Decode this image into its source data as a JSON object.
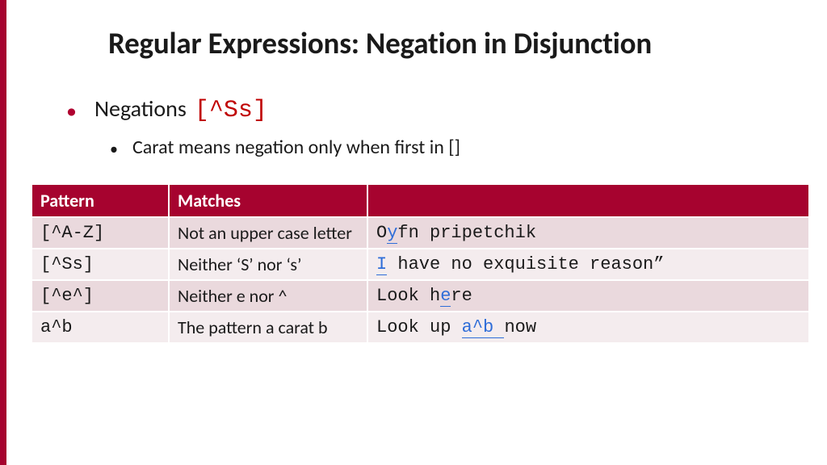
{
  "title": "Regular Expressions: Negation in Disjunction",
  "bullet1": {
    "text": "Negations",
    "code": "[^Ss]"
  },
  "bullet2": {
    "text": "Carat means negation only when first in []"
  },
  "headers": {
    "pattern": "Pattern",
    "matches": "Matches",
    "blank": ""
  },
  "rows": [
    {
      "pattern": "[^A-Z]",
      "desc": "Not an upper case letter",
      "ex_pre": "O",
      "ex_hl": "y",
      "ex_post": "fn pripetchik"
    },
    {
      "pattern": "[^Ss]",
      "desc": "Neither ‘S’ nor ‘s’",
      "ex_pre": "",
      "ex_hl": "I",
      "ex_post": " have no exquisite reason”"
    },
    {
      "pattern": "[^e^]",
      "desc": "Neither e nor ^",
      "ex_pre": "Look h",
      "ex_hl": "e",
      "ex_post": "re"
    },
    {
      "pattern": "a^b",
      "desc": "The pattern a carat b",
      "ex_pre": "Look up ",
      "ex_hl": "a^b ",
      "ex_post": "now"
    }
  ]
}
